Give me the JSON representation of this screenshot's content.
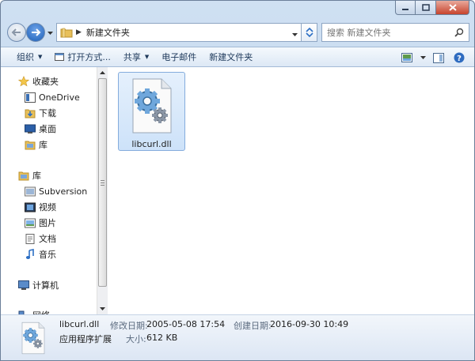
{
  "address": {
    "crumb": "新建文件夹"
  },
  "search": {
    "placeholder": "搜索 新建文件夹"
  },
  "toolbar": {
    "organize": "组织",
    "open_with": "打开方式...",
    "share": "共享",
    "email": "电子邮件",
    "new_folder": "新建文件夹"
  },
  "nav": {
    "favorites": "收藏夹",
    "onedrive": "OneDrive",
    "downloads": "下载",
    "desktop": "桌面",
    "libraries_fav": "库",
    "libraries": "库",
    "subversion": "Subversion",
    "videos": "视频",
    "pictures": "图片",
    "documents": "文档",
    "music": "音乐",
    "computer": "计算机",
    "network": "网络"
  },
  "files": [
    {
      "name": "libcurl.dll"
    }
  ],
  "details": {
    "name": "libcurl.dll",
    "type": "应用程序扩展",
    "modified_label": "修改日期:",
    "modified_value": "2005-05-08 17:54",
    "created_label": "创建日期:",
    "created_value": "2016-09-30 10:49",
    "size_label": "大小:",
    "size_value": "612 KB"
  },
  "colors": {
    "accent": "#1b5fb8",
    "selection": "#cde2f9",
    "toolbar_text": "#1e395b"
  }
}
